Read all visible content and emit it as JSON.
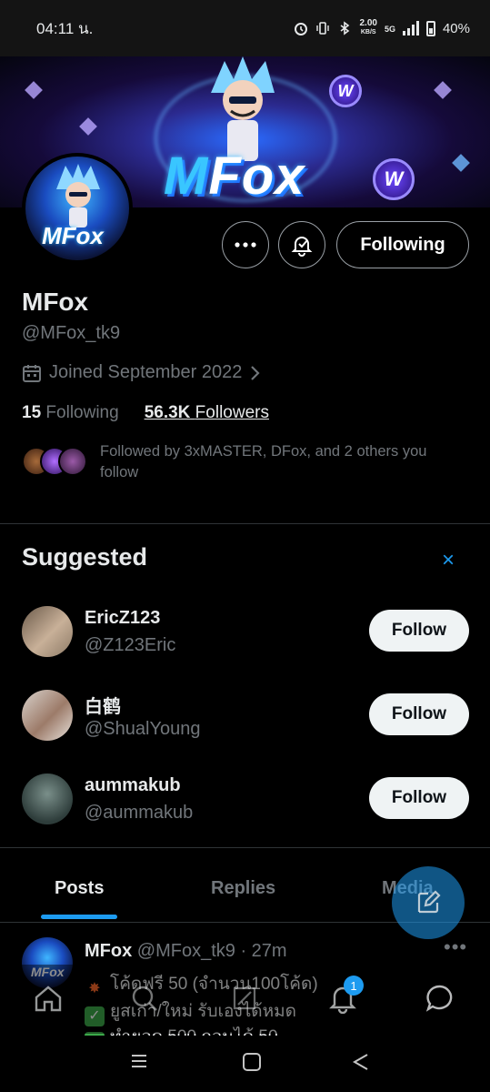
{
  "status_bar": {
    "time": "04:11 น.",
    "net_speed": "2.00",
    "net_unit": "KB/S",
    "network": "5G",
    "battery": "40%"
  },
  "banner": {
    "title_m": "M",
    "title_rest": "Fox",
    "coin_letter": "W"
  },
  "avatar": {
    "text": "MFox"
  },
  "actions": {
    "following_label": "Following"
  },
  "profile": {
    "name": "MFox",
    "handle": "@MFox_tk9",
    "joined": "Joined September 2022",
    "following_count": "15",
    "following_label": "Following",
    "followers_count": "56.3K",
    "followers_label": "Followers",
    "followed_by": "Followed by 3xMASTER, DFox, and 2 others you follow"
  },
  "suggested": {
    "title": "Suggested",
    "close": "×",
    "items": [
      {
        "name": "EricZ123",
        "handle": "@Z123Eric",
        "button": "Follow"
      },
      {
        "name": "白鹤",
        "handle": "@ShualYoung",
        "button": "Follow"
      },
      {
        "name": "aummakub",
        "handle": "@aummakub",
        "button": "Follow"
      }
    ]
  },
  "tabs": [
    {
      "label": "Posts",
      "active": true
    },
    {
      "label": "Replies",
      "active": false
    },
    {
      "label": "Media",
      "active": false
    }
  ],
  "post": {
    "author": "MFox",
    "handle": "@MFox_tk9",
    "time": "· 27m",
    "more": "•••",
    "lines": [
      "โค้ดฟรี 50 (จำนวน100โค้ด)",
      "ยูสเก่า/ใหม่ รับเองได้หมด",
      "ทำยอด 500 ถอนได้ 50"
    ],
    "line_icons": [
      "collision-icon",
      "check-mark-button-icon",
      "check-mark-button-icon"
    ]
  },
  "bottom_nav": {
    "items": [
      "home-icon",
      "search-icon",
      "grok-icon",
      "notifications-icon",
      "messages-icon"
    ],
    "notification_badge": "1"
  },
  "colors": {
    "accent": "#1d9bf0",
    "text_primary": "#e7e9ea",
    "text_secondary": "#71767b",
    "background": "#000000"
  }
}
